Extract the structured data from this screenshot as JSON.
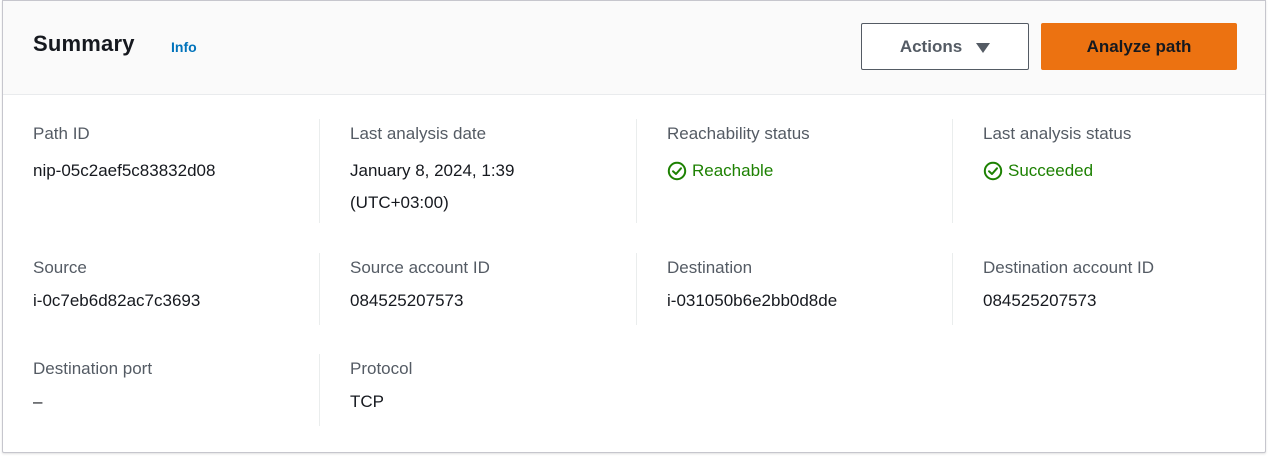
{
  "header": {
    "title": "Summary",
    "info_link": "Info",
    "actions_label": "Actions",
    "analyze_label": "Analyze path",
    "accent_color": "#ec7211",
    "link_color": "#0073bb"
  },
  "fields": {
    "path_id": {
      "label": "Path ID",
      "value": "nip-05c2aef5c83832d08"
    },
    "last_analysis_date": {
      "label": "Last analysis date",
      "value_line1": "January 8, 2024, 1:39",
      "value_line2": "(UTC+03:00)"
    },
    "reachability_status": {
      "label": "Reachability status",
      "value": "Reachable",
      "icon": "check-circle-icon",
      "color": "#1d8102"
    },
    "last_analysis_status": {
      "label": "Last analysis status",
      "value": "Succeeded",
      "icon": "check-circle-icon",
      "color": "#1d8102"
    },
    "source": {
      "label": "Source",
      "value": "i-0c7eb6d82ac7c3693"
    },
    "source_account_id": {
      "label": "Source account ID",
      "value": "084525207573"
    },
    "destination": {
      "label": "Destination",
      "value": "i-031050b6e2bb0d8de"
    },
    "destination_account_id": {
      "label": "Destination account ID",
      "value": "084525207573"
    },
    "destination_port": {
      "label": "Destination port",
      "value": "–"
    },
    "protocol": {
      "label": "Protocol",
      "value": "TCP"
    }
  }
}
